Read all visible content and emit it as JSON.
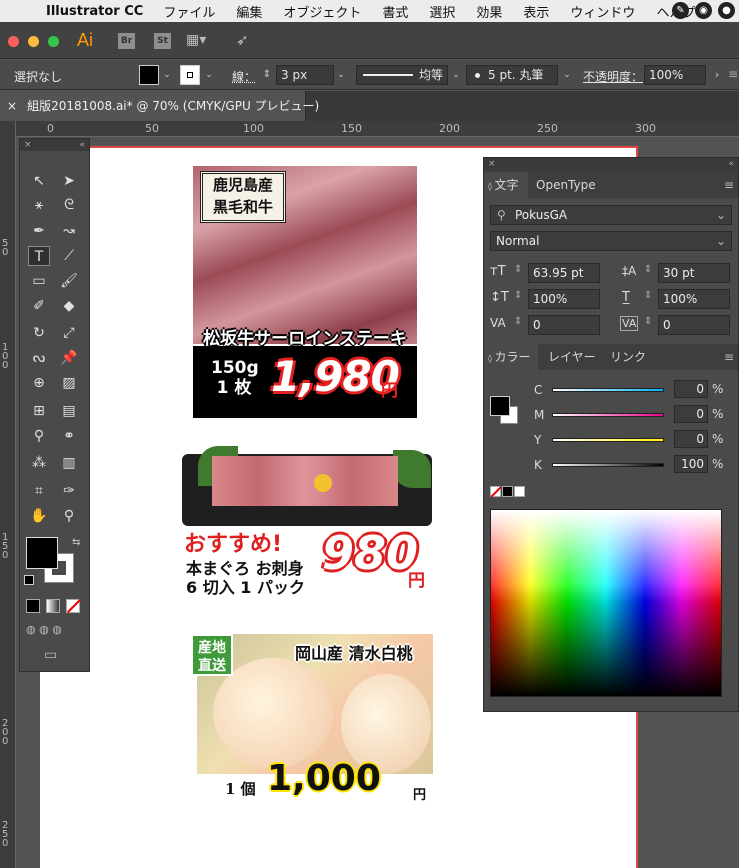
{
  "menubar": {
    "app": "Illustrator CC",
    "items": [
      "ファイル",
      "編集",
      "オブジェクト",
      "書式",
      "選択",
      "効果",
      "表示",
      "ウィンドウ",
      "ヘルプ"
    ]
  },
  "appbar": {
    "ai_label": "Ai",
    "br_label": "Br",
    "st_label": "St"
  },
  "control": {
    "selection": "選択なし",
    "stroke_label": "線：",
    "stroke_value": "3 px",
    "profile": "均等",
    "brush": "5 pt. 丸筆",
    "opacity_label": "不透明度：",
    "opacity_value": "100%"
  },
  "doc": {
    "tab_title": "組版20181008.ai* @ 70% (CMYK/GPU プレビュー)"
  },
  "ruler": {
    "h": [
      "0",
      "50",
      "100",
      "150",
      "200",
      "250",
      "300"
    ],
    "v": [
      "50",
      "100",
      "150",
      "200",
      "250"
    ]
  },
  "char_panel": {
    "tab1": "文字",
    "tab2": "OpenType",
    "font": "PokusGA",
    "style": "Normal",
    "size": "63.95 pt",
    "leading": "30 pt",
    "vscale": "100%",
    "hscale": "100%",
    "kern": "0",
    "track": "0"
  },
  "color_panel": {
    "tab1": "カラー",
    "tab2": "レイヤー",
    "tab3": "リンク",
    "c": "0",
    "m": "0",
    "y": "0",
    "k": "100",
    "pct": "%"
  },
  "art": {
    "beef": {
      "brand1": "鹿児島産",
      "brand2": "黒毛和牛",
      "title": "松坂牛サーロインステーキ",
      "qty1": "150g",
      "qty2": "1 枚",
      "price": "1,980",
      "yen": "円"
    },
    "tuna": {
      "tag": "おすすめ!",
      "line1": "本まぐろ お刺身",
      "line2": "6 切入 1 パック",
      "price": "980",
      "yen": "円"
    },
    "peach": {
      "badge1": "産地",
      "badge2": "直送",
      "title": "岡山産 清水白桃",
      "unit": "1 個",
      "price": "1,000",
      "yen": "円"
    }
  }
}
